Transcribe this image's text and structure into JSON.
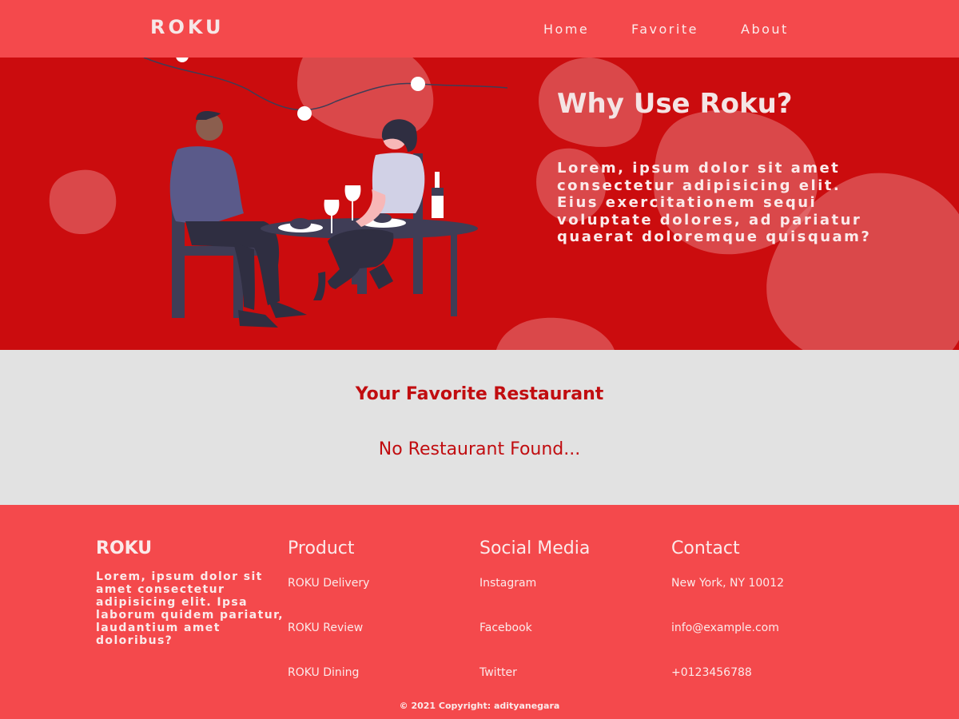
{
  "header": {
    "brand": "ROKU",
    "nav": [
      "Home",
      "Favorite",
      "About"
    ]
  },
  "hero": {
    "title": "Why Use Roku?",
    "text": " Lorem, ipsum dolor sit amet consectetur adipisicing elit. Eius exercitationem sequi voluptate dolores, ad pariatur quaerat doloremque quisquam?"
  },
  "main": {
    "title": "Your Favorite Restaurant",
    "empty_message": "No Restaurant Found..."
  },
  "footer": {
    "brand": "ROKU",
    "about": " Lorem, ipsum dolor sit amet consectetur adipisicing elit. Ipsa laborum quidem pariatur, laudantium amet doloribus?",
    "product": {
      "title": "Product",
      "links": [
        "ROKU Delivery",
        "ROKU Review",
        "ROKU Dining"
      ]
    },
    "social": {
      "title": "Social Media",
      "links": [
        "Instagram",
        "Facebook",
        "Twitter"
      ]
    },
    "contact": {
      "title": "Contact",
      "items": [
        "New York, NY 10012",
        "info@example.com",
        "+0123456788"
      ]
    },
    "copyright": "© 2021 Copyright: adityanegara"
  },
  "colors": {
    "header_bg": "#f4494c",
    "hero_bg": "#cb0c0e",
    "main_bg": "#e2e2e2",
    "accent_text": "#c10d10"
  }
}
